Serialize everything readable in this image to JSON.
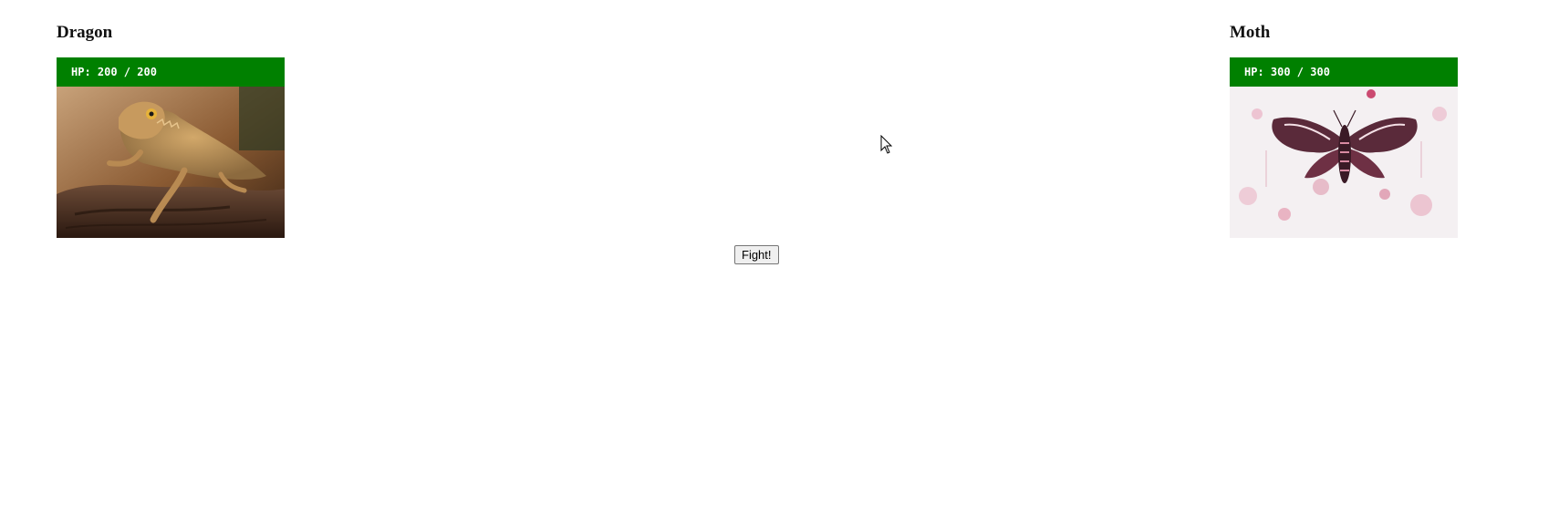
{
  "fighters": [
    {
      "name": "Dragon",
      "hp_text": "HP: 200 / 200",
      "hp_current": 200,
      "hp_max": 200,
      "hp_color": "#008000",
      "portrait": "bearded-dragon-lizard-on-log"
    },
    {
      "name": "Moth",
      "hp_text": "HP: 300 / 300",
      "hp_current": 300,
      "hp_max": 300,
      "hp_color": "#008000",
      "portrait": "pink-ink-moth-painting"
    }
  ],
  "actions": {
    "fight_label": "Fight!"
  },
  "cursor": {
    "icon": "arrow-cursor-icon"
  }
}
